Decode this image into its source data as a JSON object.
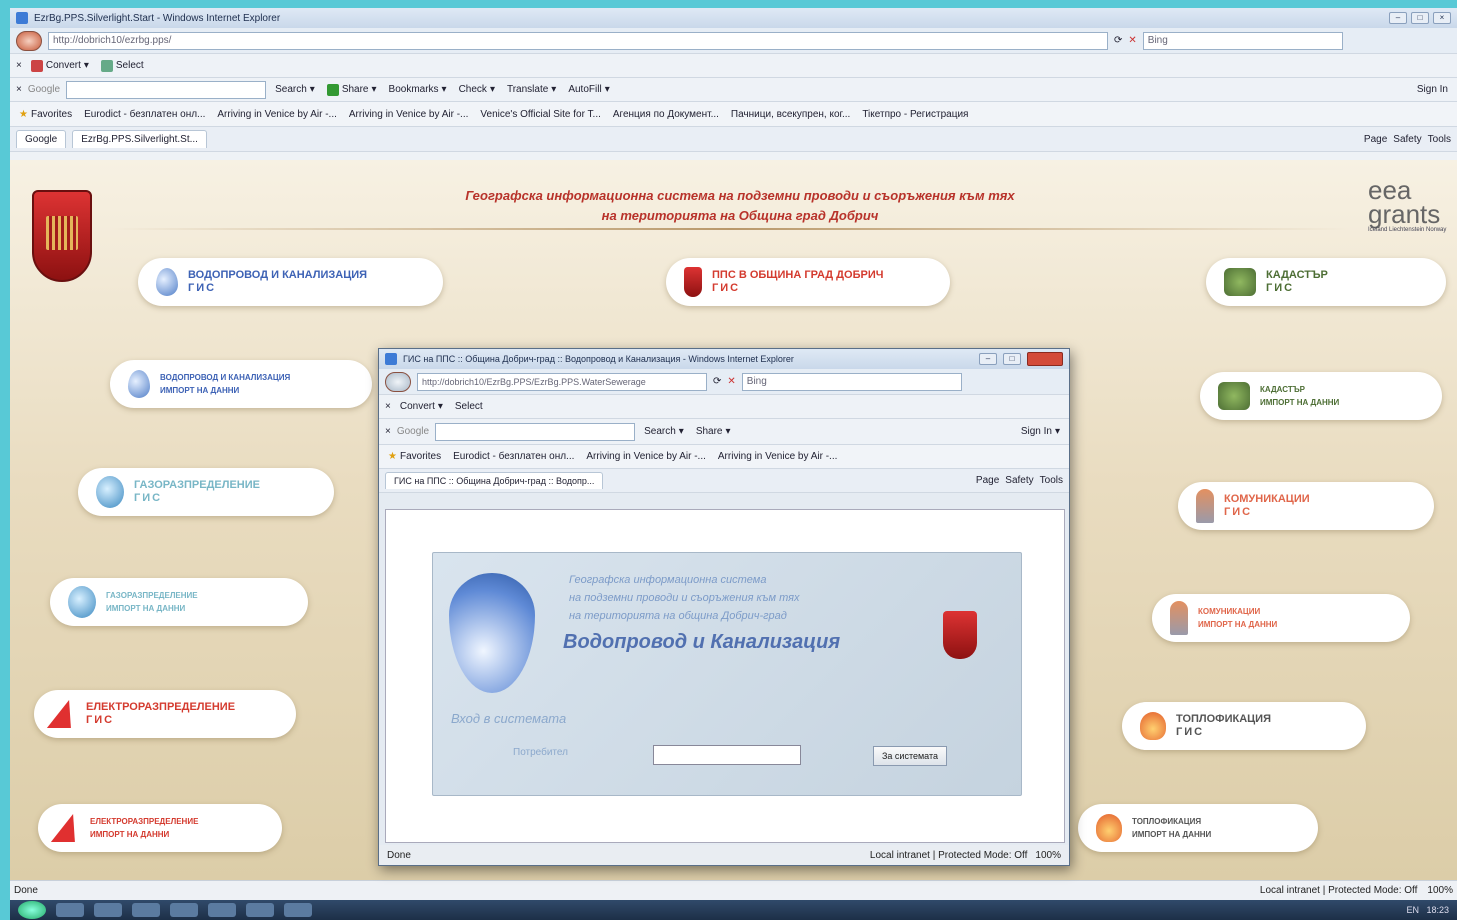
{
  "window": {
    "title": "EzrBg.PPS.Silverlight.Start - Windows Internet Explorer",
    "address": "http://dobrich10/ezrbg.pps/",
    "search_placeholder": "Bing"
  },
  "toolbars": {
    "convert": "Convert",
    "select": "Select",
    "google": "Google",
    "search": "Search",
    "share": "Share",
    "bookmarks": "Bookmarks",
    "check": "Check",
    "translate": "Translate",
    "autofill": "AutoFill",
    "sign_in": "Sign In"
  },
  "favorites": {
    "label": "Favorites",
    "items": [
      "Eurodict - безплатен онл...",
      "Arriving in Venice by Air -...",
      "Arriving in Venice by Air -...",
      "Venice's Official Site for T...",
      "Агенция по Документ...",
      "Пачници, всекупрен, ког...",
      "Tiкетпро - Регистрация"
    ]
  },
  "tabs": [
    {
      "label": "Google"
    },
    {
      "label": "EzrBg.PPS.Silverlight.St..."
    }
  ],
  "command_bar": {
    "page": "Page",
    "safety": "Safety",
    "tools": "Tools"
  },
  "header": {
    "line1": "Географска информационна система на подземни проводи и съоръжения към тях",
    "line2": "на територията на Община град Добрич",
    "eea": "eea",
    "grants": "grants",
    "eea_small": "Iceland Liechtenstein Norway"
  },
  "tiles": {
    "vik_gis": {
      "l1": "ВОДОПРОВОД И КАНАЛИЗАЦИЯ",
      "l2": "ГИС"
    },
    "pps_gis": {
      "l1": "ППС В ОБЩИНА ГРАД ДОБРИЧ",
      "l2": "ГИС"
    },
    "kad_gis": {
      "l1": "КАДАСТЪР",
      "l2": "ГИС"
    },
    "vik_import": {
      "l1": "ВОДОПРОВОД И КАНАЛИЗАЦИЯ",
      "l2": "ИМПОРТ НА ДАННИ"
    },
    "kad_import": {
      "l1": "КАДАСТЪР",
      "l2": "ИМПОРТ НА ДАННИ"
    },
    "gas_gis": {
      "l1": "ГАЗОРАЗПРЕДЕЛЕНИЕ",
      "l2": "ГИС"
    },
    "kom_gis": {
      "l1": "КОМУНИКАЦИИ",
      "l2": "ГИС"
    },
    "gas_import": {
      "l1": "ГАЗОРАЗПРЕДЕЛЕНИЕ",
      "l2": "ИМПОРТ НА ДАННИ"
    },
    "kom_import": {
      "l1": "КОМУНИКАЦИИ",
      "l2": "ИМПОРТ НА ДАННИ"
    },
    "el_gis": {
      "l1": "ЕЛЕКТРОРАЗПРЕДЕЛЕНИЕ",
      "l2": "ГИС"
    },
    "top_gis": {
      "l1": "ТОПЛОФИКАЦИЯ",
      "l2": "ГИС"
    },
    "el_import": {
      "l1": "ЕЛЕКТРОРАЗПРЕДЕЛЕНИЕ",
      "l2": "ИМПОРТ НА ДАННИ"
    },
    "top_import": {
      "l1": "ТОПЛОФИКАЦИЯ",
      "l2": "ИМПОРТ НА ДАННИ"
    }
  },
  "popup": {
    "title": "ГИС на ППС :: Община Добрич-град :: Водопровод и Канализация - Windows Internet Explorer",
    "address": "http://dobrich10/EzrBg.PPS/EzrBg.PPS.WaterSewerage",
    "search_placeholder": "Bing",
    "tab": "ГИС на ППС :: Община Добрич-град :: Водопр...",
    "sub1": "Географска информационна система",
    "sub2": "на подземни проводи и съоръжения към тях",
    "sub3": "на територията на община Добрич-град",
    "title_big": "Водопровод и Канализация",
    "login_label": "Вход в системата",
    "user_label": "Потребител",
    "login_button": "За системата",
    "status_done": "Done",
    "status_zone": "Local intranet | Protected Mode: Off",
    "zoom": "100%"
  },
  "status": {
    "done": "Done",
    "zone": "Local intranet | Protected Mode: Off",
    "zoom": "100%"
  },
  "taskbar": {
    "lang": "EN",
    "time": "18:23"
  }
}
